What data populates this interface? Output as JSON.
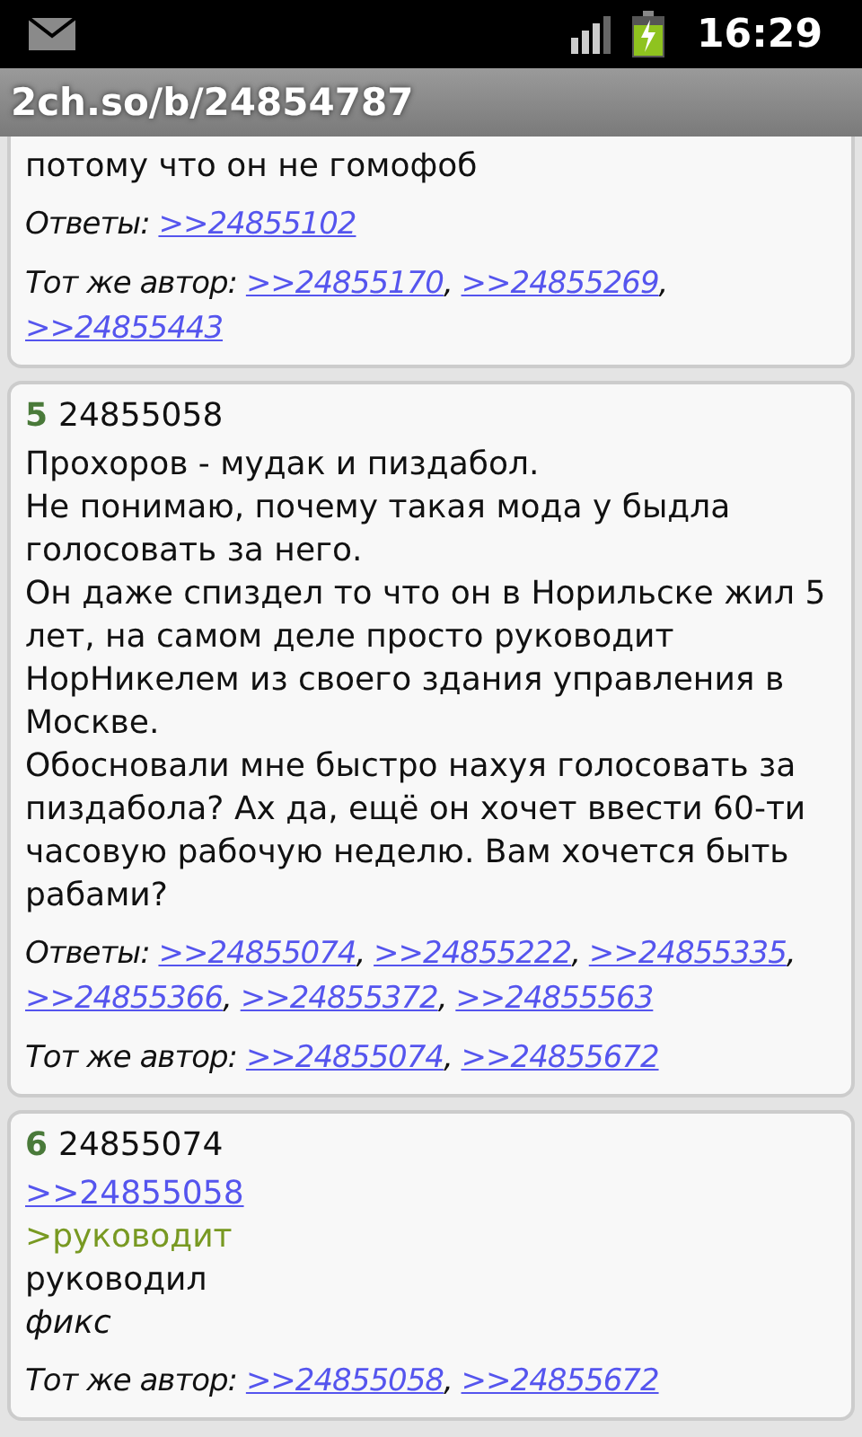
{
  "status_bar": {
    "time": "16:29"
  },
  "title_bar": {
    "title": "2ch.so/b/24854787"
  },
  "posts": [
    {
      "body": [
        {
          "kind": "text",
          "text": "потому что он не гомофоб"
        }
      ],
      "replies": {
        "label": "Ответы:",
        "links": [
          ">>24855102"
        ]
      },
      "same_author": {
        "label": "Тот же автор:",
        "separator": ",",
        "links": [
          ">>24855170",
          ">>24855269",
          ">>24855443"
        ]
      }
    },
    {
      "number": "5",
      "id": "24855058",
      "body": [
        {
          "kind": "text",
          "text": "Прохоров - мудак и пиздабол."
        },
        {
          "kind": "text",
          "text": "Не понимаю, почему такая мода у быдла голосовать за него."
        },
        {
          "kind": "text",
          "text": "Он даже спиздел то что он в Норильске жил 5 лет, на самом деле просто руководит НорНикелем из своего здания управления в Москве."
        },
        {
          "kind": "text",
          "text": "Обосновали мне быстро нахуя голосовать за пиздабола? Ах да, ещё он хочет ввести 60-ти часовую рабочую неделю. Вам хочется быть рабами?"
        }
      ],
      "replies": {
        "label": "Ответы:",
        "separator": ",",
        "links": [
          ">>24855074",
          ">>24855222",
          ">>24855335",
          ">>24855366",
          ">>24855372",
          ">>24855563"
        ]
      },
      "same_author": {
        "label": "Тот же автор:",
        "separator": ",",
        "links": [
          ">>24855074",
          ">>24855672"
        ]
      }
    },
    {
      "number": "6",
      "id": "24855074",
      "body": [
        {
          "kind": "link",
          "text": ">>24855058"
        },
        {
          "kind": "quote",
          "text": ">руководит"
        },
        {
          "kind": "text",
          "text": "руководил"
        },
        {
          "kind": "italic",
          "text": "фикс"
        }
      ],
      "same_author": {
        "label": "Тот же автор:",
        "separator": ",",
        "links": [
          ">>24855058",
          ">>24855672"
        ]
      }
    }
  ]
}
